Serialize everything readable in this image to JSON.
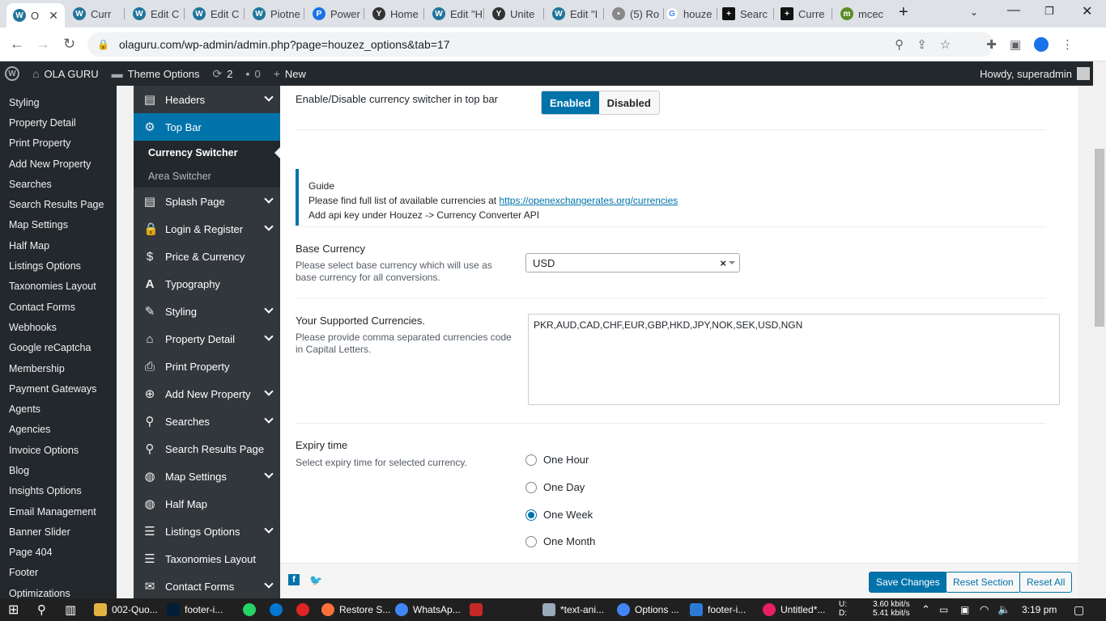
{
  "browser": {
    "tabs": [
      {
        "label": "O",
        "color": "#21759b"
      },
      {
        "label": "Curr",
        "color": "#21759b"
      },
      {
        "label": "Edit C",
        "color": "#21759b"
      },
      {
        "label": "Edit C",
        "color": "#21759b"
      },
      {
        "label": "Piotne",
        "color": "#21759b"
      },
      {
        "label": "Power",
        "color": "#1a73e8"
      },
      {
        "label": "Home",
        "color": "#333"
      },
      {
        "label": "Edit \"H",
        "color": "#21759b"
      },
      {
        "label": "Unite",
        "color": "#333"
      },
      {
        "label": "Edit \"I",
        "color": "#21759b"
      },
      {
        "label": "(5) Ro",
        "color": "#888"
      },
      {
        "label": "houze",
        "color": "#4285f4"
      },
      {
        "label": "Searc",
        "color": "#111"
      },
      {
        "label": "Curre",
        "color": "#111"
      },
      {
        "label": "mcec",
        "color": "#5b8c2a"
      }
    ],
    "url": "olaguru.com/wp-admin/admin.php?page=houzez_options&tab=17"
  },
  "adminbar": {
    "site_name": "OLA GURU",
    "theme_options": "Theme Options",
    "updates": "2",
    "comments": "0",
    "new": "New",
    "howdy": "Howdy, superadmin"
  },
  "wp_menu": [
    "Styling",
    "Property Detail",
    "Print Property",
    "Add New Property",
    "Searches",
    "Search Results Page",
    "Map Settings",
    "Half Map",
    "Listings Options",
    "Taxonomies Layout",
    "Contact Forms",
    "Webhooks",
    "Google reCaptcha",
    "Membership",
    "Payment Gateways",
    "Agents",
    "Agencies",
    "Invoice Options",
    "Blog",
    "Insights Options",
    "Email Management",
    "Banner Slider",
    "Page 404",
    "Footer",
    "Optimizations"
  ],
  "options_menu": {
    "headers": "Headers",
    "top_bar": "Top Bar",
    "sub_currency": "Currency Switcher",
    "sub_area": "Area Switcher",
    "splash": "Splash Page",
    "login": "Login & Register",
    "price": "Price & Currency",
    "typography": "Typography",
    "styling": "Styling",
    "property_detail": "Property Detail",
    "print_property": "Print Property",
    "add_new": "Add New Property",
    "searches": "Searches",
    "search_results": "Search Results Page",
    "map_settings": "Map Settings",
    "half_map": "Half Map",
    "listings": "Listings Options",
    "taxonomies": "Taxonomies Layout",
    "contact": "Contact Forms"
  },
  "settings": {
    "switcher_label": "Enable/Disable currency switcher in top bar",
    "enabled": "Enabled",
    "disabled": "Disabled",
    "guide_title": "Guide",
    "guide_line1": "Please find full list of available currencies at",
    "guide_link": "https://openexchangerates.org/currencies",
    "guide_line2": "Add api key under Houzez -> Currency Converter API",
    "base_label": "Base Currency",
    "base_desc": "Please select base currency which will use as base currency for all conversions.",
    "base_value": "USD",
    "supported_label": "Your Supported Currencies.",
    "supported_desc": "Please provide comma separated currencies code in Capital Letters.",
    "supported_value": "PKR,AUD,CAD,CHF,EUR,GBP,HKD,JPY,NOK,SEK,USD,NGN",
    "expiry_label": "Expiry time",
    "expiry_desc": "Select expiry time for selected currency.",
    "expiry_options": [
      "One Hour",
      "One Day",
      "One Week",
      "One Month"
    ],
    "expiry_selected": "One Week"
  },
  "footer": {
    "save": "Save Changes",
    "reset_section": "Reset Section",
    "reset_all": "Reset All"
  },
  "taskbar": {
    "items": [
      "002-Quo...",
      "footer-i...",
      "",
      "",
      "",
      "Restore S...",
      "WhatsAp...",
      "",
      "*text-ani...",
      "Options ...",
      "footer-i...",
      "Untitled*..."
    ],
    "net_up": "3.60 kbit/s",
    "net_down": "5.41 kbit/s",
    "u": "U:",
    "d": "D:",
    "time": "3:19 pm"
  }
}
